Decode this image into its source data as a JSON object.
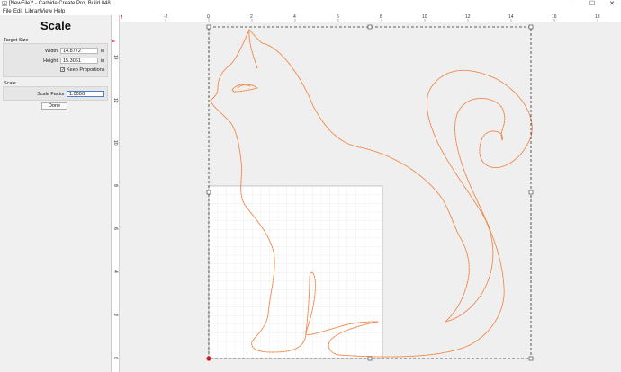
{
  "window": {
    "title": "[NewFile]* - Carbide Create Pro, Build 848",
    "minimize_glyph": "—",
    "maximize_glyph": "☐",
    "close_glyph": "✕"
  },
  "menu": [
    "File",
    "Edit",
    "Library",
    "View",
    "Help"
  ],
  "panel": {
    "title": "Scale",
    "target_size": {
      "label": "Target Size",
      "width_label": "Width",
      "width_value": "14.8772",
      "width_unit": "in",
      "height_label": "Height",
      "height_value": "15.3061",
      "height_unit": "in",
      "keep_proportions_label": "Keep Proportions",
      "keep_proportions": true
    },
    "scale": {
      "label": "Scale",
      "factor_label": "Scale Factor",
      "factor_value": "1.000/2"
    },
    "done_label": "Done"
  },
  "rulers": {
    "top_ticks": [
      "-2",
      "0",
      "2",
      "4",
      "6",
      "8",
      "10",
      "12",
      "14",
      "16",
      "18"
    ],
    "left_ticks": [
      "14",
      "12",
      "10",
      "8",
      "6",
      "4",
      "2",
      "0"
    ]
  },
  "colors": {
    "toolpath": "#f0803c",
    "stock_grid": "#dcdcdc",
    "selection": "#303030",
    "origin": "#d21e1e"
  }
}
